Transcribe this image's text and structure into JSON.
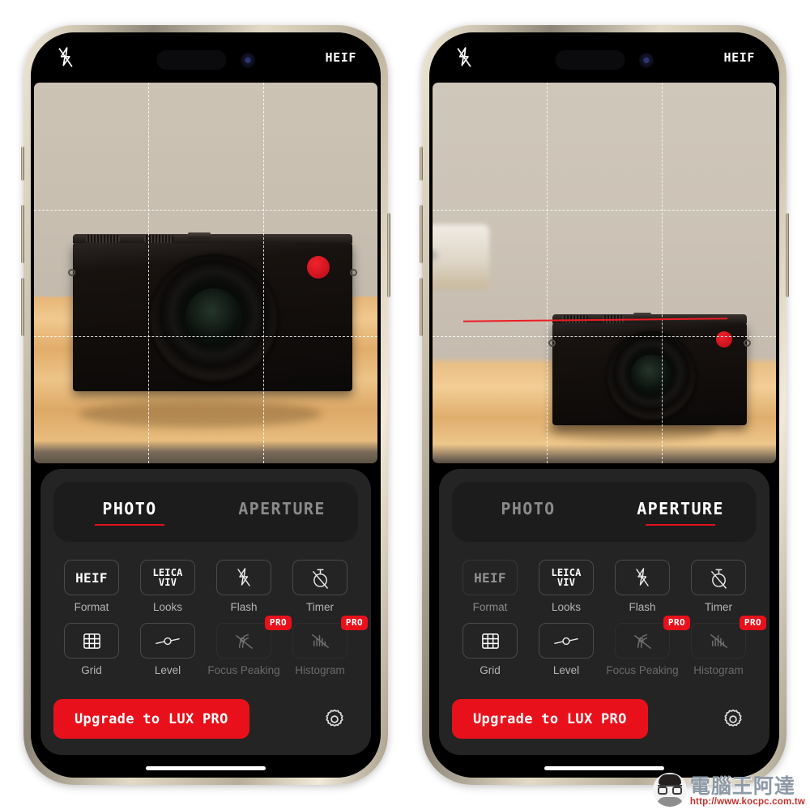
{
  "page": {
    "background": "#ffffff",
    "accent_red": "#e8111b",
    "panel_bg": "#242424"
  },
  "watermark": {
    "site_name": "電腦王阿達",
    "url": "http://www.kocpc.com.tw"
  },
  "phones": [
    {
      "id": "phone-left",
      "statusbar": {
        "flash_icon": "flash-off-icon",
        "format_label": "HEIF"
      },
      "viewfinder": {
        "scene": "leica-camera-on-wood-table-closeup",
        "grid_visible": true,
        "level_visible": false
      },
      "panel": {
        "tabs": [
          {
            "label": "PHOTO",
            "active": true
          },
          {
            "label": "APERTURE",
            "active": false
          }
        ],
        "tiles": [
          {
            "icon": "heif-format-icon",
            "box_text": "HEIF",
            "label": "Format",
            "state": "active",
            "pro": false
          },
          {
            "icon": "leica-looks-icon",
            "box_text": "LEICA VIV",
            "label": "Looks",
            "state": "active",
            "pro": false
          },
          {
            "icon": "flash-off-icon",
            "box_text": "",
            "label": "Flash",
            "state": "active",
            "pro": false
          },
          {
            "icon": "timer-off-icon",
            "box_text": "",
            "label": "Timer",
            "state": "active",
            "pro": false
          },
          {
            "icon": "grid-icon",
            "box_text": "",
            "label": "Grid",
            "state": "active",
            "pro": false
          },
          {
            "icon": "level-icon",
            "box_text": "",
            "label": "Level",
            "state": "active",
            "pro": false
          },
          {
            "icon": "focus-peaking-off-icon",
            "box_text": "",
            "label": "Focus Peaking",
            "state": "locked",
            "pro": true
          },
          {
            "icon": "histogram-off-icon",
            "box_text": "",
            "label": "Histogram",
            "state": "locked",
            "pro": true
          }
        ],
        "pro_badge_label": "PRO",
        "upgrade_label": "Upgrade to LUX PRO",
        "settings_icon": "gear-icon"
      }
    },
    {
      "id": "phone-right",
      "statusbar": {
        "flash_icon": "flash-off-icon",
        "format_label": "HEIF"
      },
      "viewfinder": {
        "scene": "leica-camera-on-wood-table-wide",
        "grid_visible": true,
        "level_visible": true
      },
      "panel": {
        "tabs": [
          {
            "label": "PHOTO",
            "active": false
          },
          {
            "label": "APERTURE",
            "active": true
          }
        ],
        "tiles": [
          {
            "icon": "heif-format-icon",
            "box_text": "HEIF",
            "label": "Format",
            "state": "disabled",
            "pro": false
          },
          {
            "icon": "leica-looks-icon",
            "box_text": "LEICA VIV",
            "label": "Looks",
            "state": "active",
            "pro": false
          },
          {
            "icon": "flash-off-icon",
            "box_text": "",
            "label": "Flash",
            "state": "active",
            "pro": false
          },
          {
            "icon": "timer-off-icon",
            "box_text": "",
            "label": "Timer",
            "state": "active",
            "pro": false
          },
          {
            "icon": "grid-icon",
            "box_text": "",
            "label": "Grid",
            "state": "active",
            "pro": false
          },
          {
            "icon": "level-icon",
            "box_text": "",
            "label": "Level",
            "state": "active",
            "pro": false
          },
          {
            "icon": "focus-peaking-off-icon",
            "box_text": "",
            "label": "Focus Peaking",
            "state": "locked",
            "pro": true
          },
          {
            "icon": "histogram-off-icon",
            "box_text": "",
            "label": "Histogram",
            "state": "locked",
            "pro": true
          }
        ],
        "pro_badge_label": "PRO",
        "upgrade_label": "Upgrade to LUX PRO",
        "settings_icon": "gear-icon"
      }
    }
  ],
  "leica_box": {
    "line1": "LEICA",
    "line2": "VIV"
  }
}
